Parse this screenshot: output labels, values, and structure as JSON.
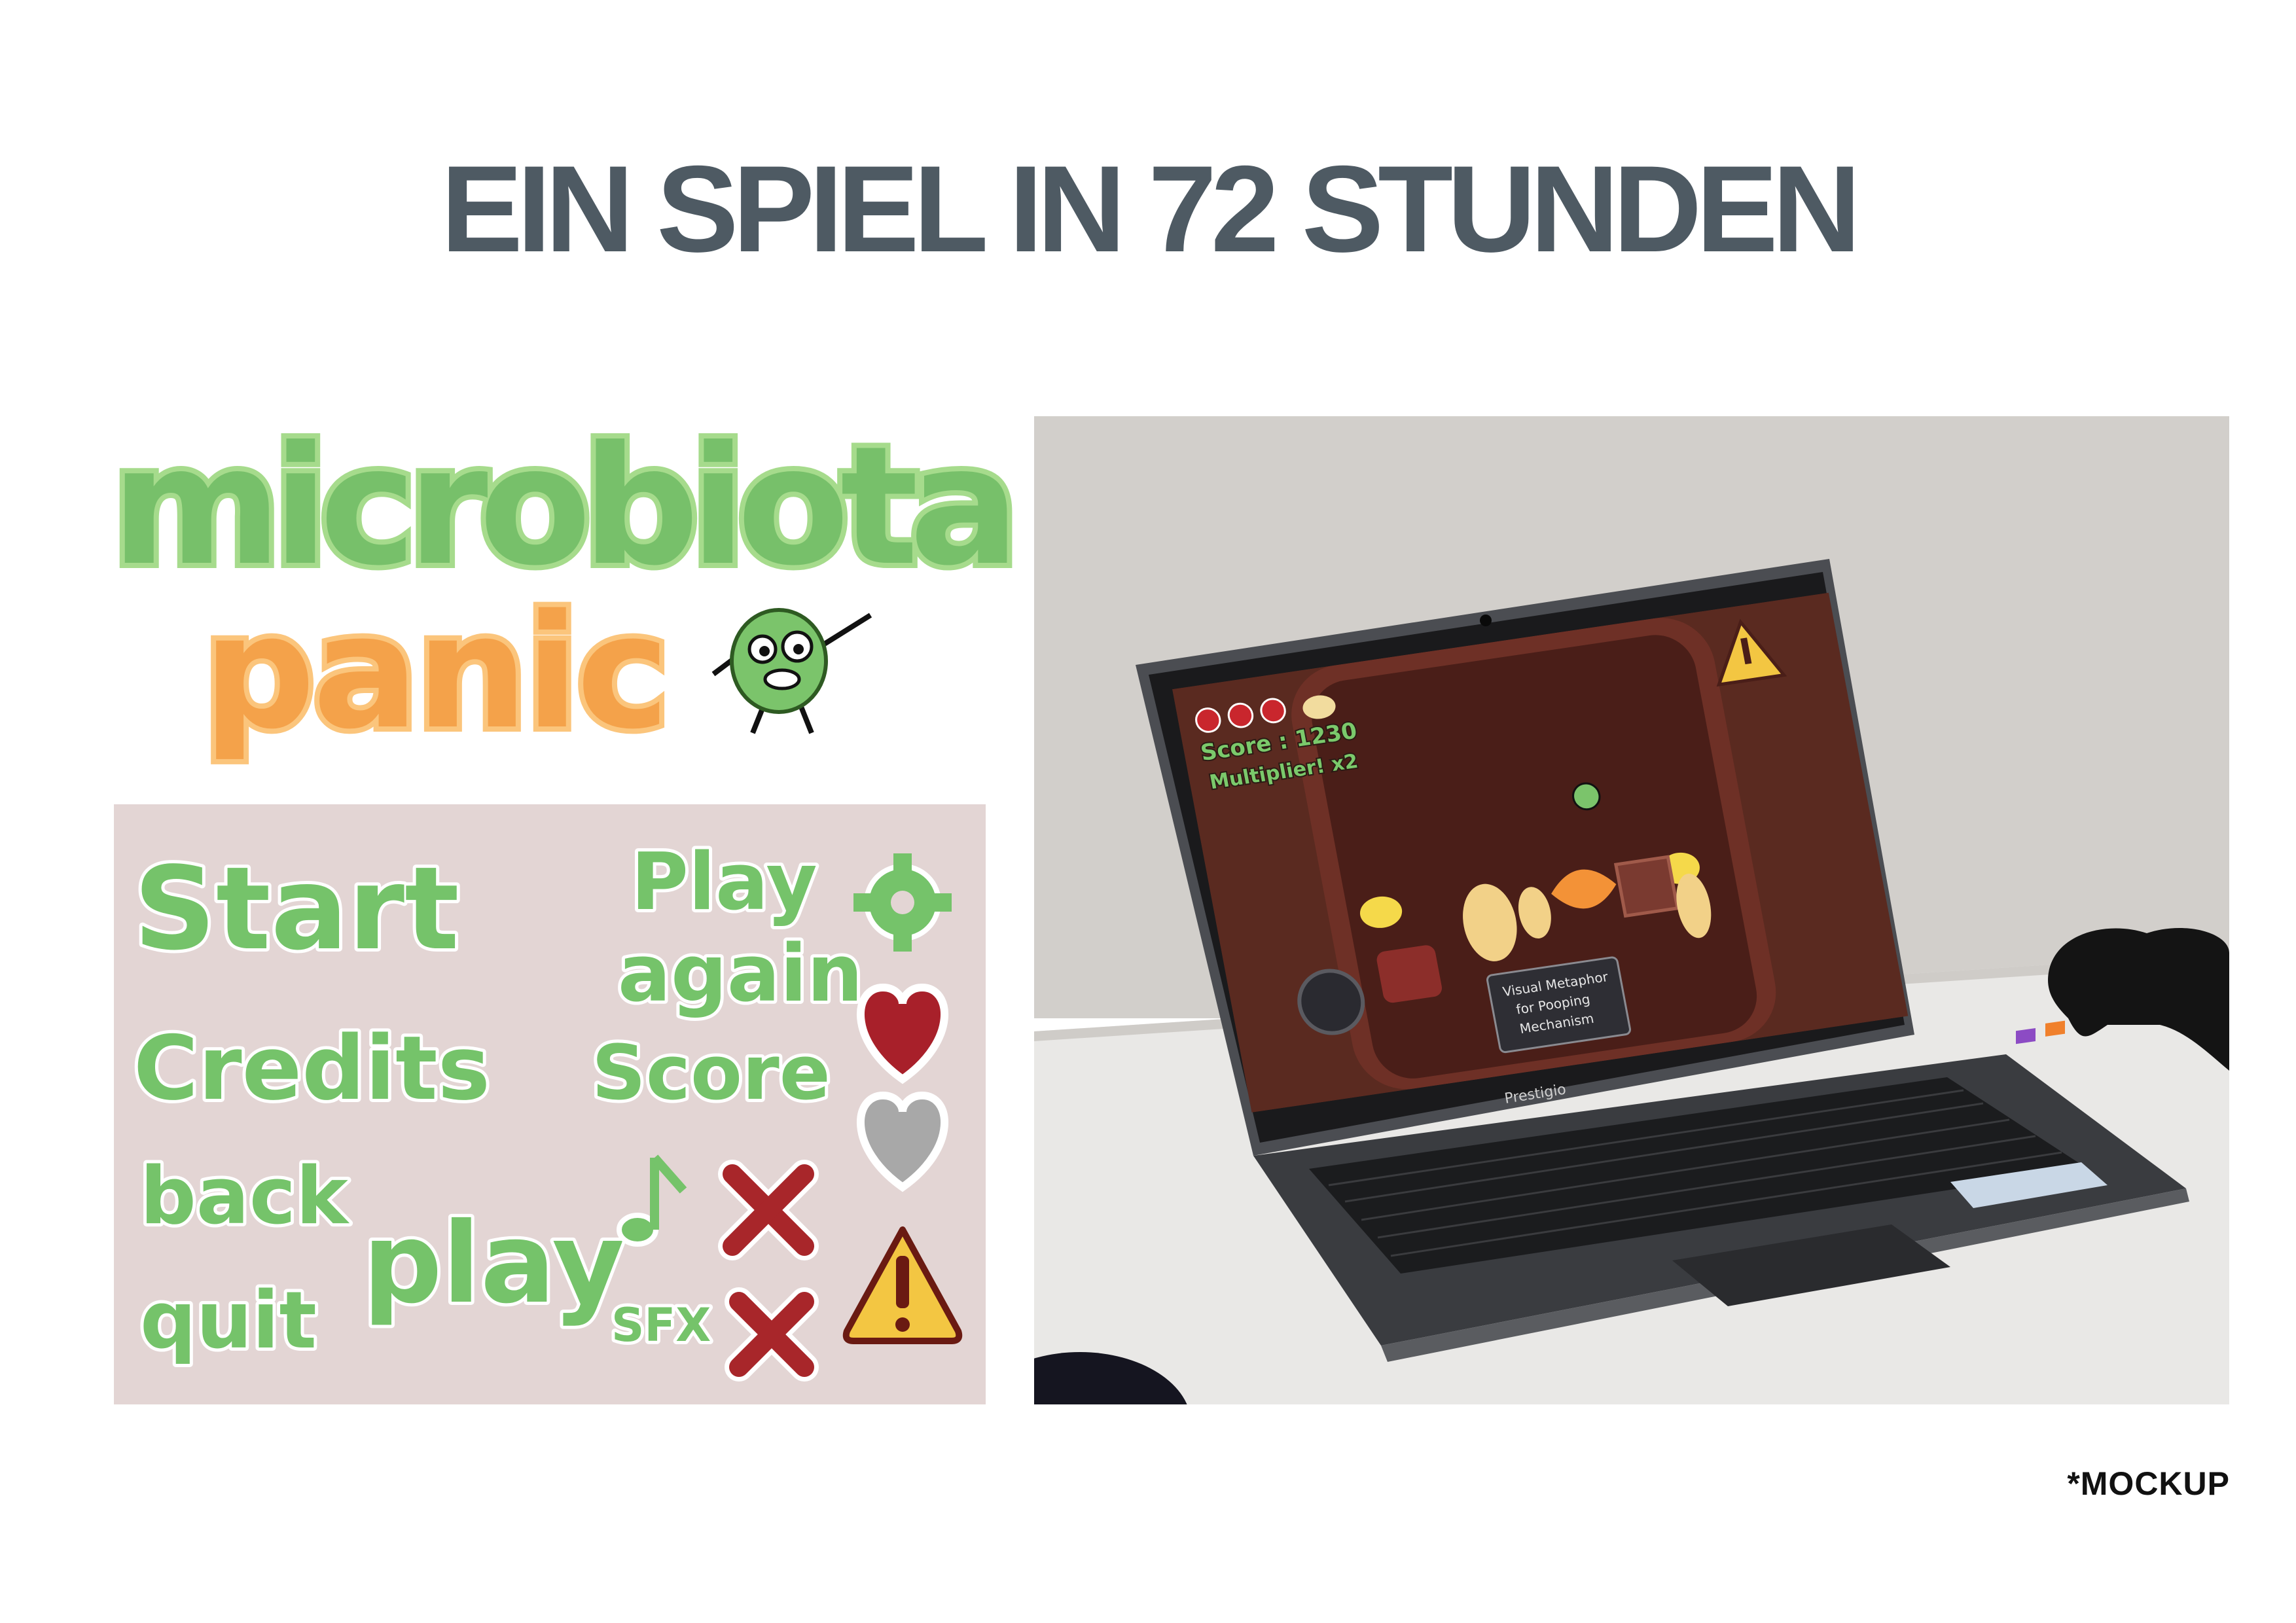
{
  "page": {
    "title": "EIN SPIEL IN 72 STUNDEN",
    "footnote": "*MOCKUP"
  },
  "logo": {
    "line1": "microbiota",
    "line2": "panic",
    "colors": {
      "green": "#77c06a",
      "orange": "#f4a24a"
    }
  },
  "asset_sheet": {
    "background": "#e3d5d4",
    "labels": {
      "start": "Start",
      "credits": "Credits",
      "back": "back",
      "quit": "quit",
      "play": "play",
      "play_again_1": "Play",
      "play_again_2": "again",
      "score": "Score",
      "sfx": "SFX"
    },
    "icons": [
      "gear-icon",
      "heart-full-icon",
      "heart-empty-icon",
      "warning-icon",
      "music-note-icon",
      "mute-cross-icon",
      "sfx-cross-icon"
    ]
  },
  "game_screen": {
    "score_label": "Score : 1230",
    "multiplier_label": "Multiplier! x2",
    "lives": 3,
    "sign_line1": "Visual Metaphor",
    "sign_line2": "for Pooping",
    "sign_line3": "Mechanism",
    "laptop_brand": "Prestigio"
  }
}
